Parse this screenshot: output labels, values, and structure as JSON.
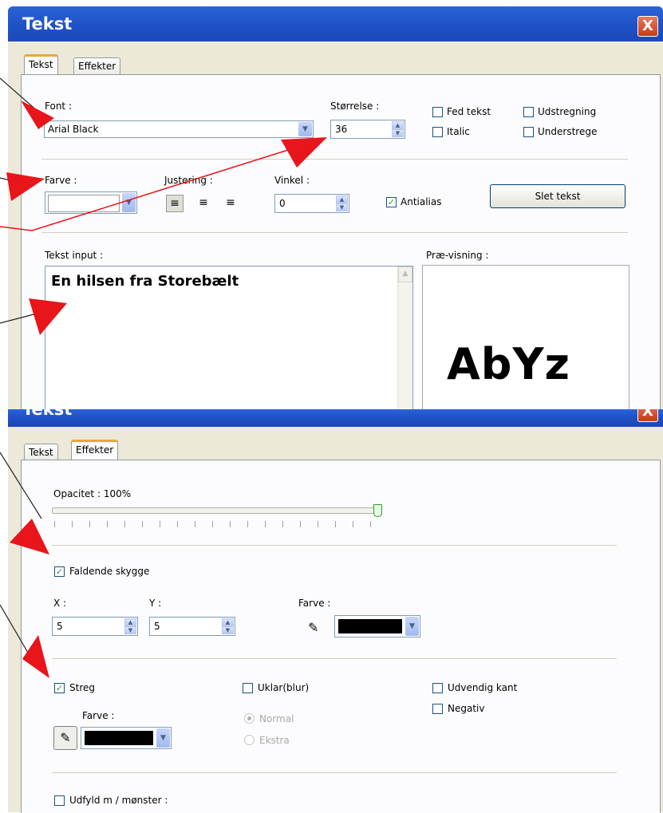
{
  "top_dialog": {
    "title": "Tekst",
    "close": "X",
    "tabs": [
      {
        "label": "Tekst",
        "active": true
      },
      {
        "label": "Effekter",
        "active": false
      }
    ],
    "font": {
      "label": "Font :",
      "value": "Arial Black"
    },
    "size": {
      "label": "Størrelse :",
      "value": "36"
    },
    "checks": {
      "bold": {
        "label": "Fed tekst",
        "checked": false
      },
      "strike": {
        "label": "Udstregning",
        "checked": false
      },
      "italic": {
        "label": "Italic",
        "checked": false
      },
      "underline": {
        "label": "Understrege",
        "checked": false
      }
    },
    "color": {
      "label": "Farve :"
    },
    "justify": {
      "label": "Justering :"
    },
    "angle": {
      "label": "Vinkel :",
      "value": "0"
    },
    "antialias": {
      "label": "Antialias",
      "checked": true
    },
    "delete_button": "Slet tekst",
    "text_input": {
      "label": "Tekst input :",
      "value": "En hilsen fra Storebælt"
    },
    "preview": {
      "label": "Præ-visning :",
      "sample": "AbYz"
    }
  },
  "bottom_dialog": {
    "title": "Tekst",
    "close": "X",
    "tabs": [
      {
        "label": "Tekst",
        "active": false
      },
      {
        "label": "Effekter",
        "active": true
      }
    ],
    "opacity": {
      "label": "Opacitet : 100%",
      "value_percent": 100
    },
    "shadow": {
      "label": "Faldende skygge",
      "checked": true
    },
    "x": {
      "label": "X :",
      "value": "5"
    },
    "y": {
      "label": "Y :",
      "value": "5"
    },
    "shadow_color_label": "Farve :",
    "stroke": {
      "label": "Streg",
      "checked": true
    },
    "stroke_color_label": "Farve :",
    "blur": {
      "label": "Uklar(blur)",
      "checked": false
    },
    "blur_normal": "Normal",
    "blur_extra": "Ekstra",
    "outer_edge": {
      "label": "Udvendig kant",
      "checked": false
    },
    "negative": {
      "label": "Negativ",
      "checked": false
    },
    "pattern": {
      "label": "Udfyld m / mønster :",
      "checked": false
    }
  },
  "colors": {
    "annotation_arrow": "#e8151b",
    "titlebar": "#2058d0",
    "tab_highlight": "#e9a637"
  }
}
